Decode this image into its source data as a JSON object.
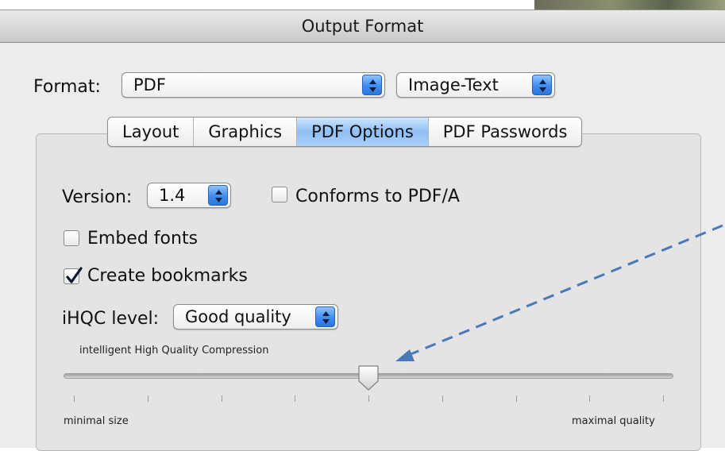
{
  "window": {
    "title": "Output Format"
  },
  "format": {
    "label": "Format:",
    "value": "PDF",
    "mode_value": "Image-Text"
  },
  "tabs": [
    {
      "label": "Layout"
    },
    {
      "label": "Graphics"
    },
    {
      "label": "PDF Options",
      "active": true
    },
    {
      "label": "PDF Passwords"
    }
  ],
  "pdf_options": {
    "version_label": "Version:",
    "version_value": "1.4",
    "conforms_label": "Conforms to PDF/A",
    "conforms_checked": false,
    "embed_fonts_label": "Embed fonts",
    "embed_fonts_checked": false,
    "create_bookmarks_label": "Create bookmarks",
    "create_bookmarks_checked": true,
    "ihqc_label": "iHQC level:",
    "ihqc_value": "Good quality",
    "ihqc_caption": "intelligent High Quality Compression",
    "slider": {
      "min_label": "minimal size",
      "max_label": "maximal quality",
      "value_fraction": 0.5,
      "tick_count": 9
    }
  },
  "colors": {
    "accent": "#3f8df0",
    "annotation_arrow": "#4a78b8"
  },
  "icons": {
    "stepper": "up-down-arrows-icon",
    "checkmark": "checkmark-icon",
    "slider_knob": "slider-knob-icon",
    "annotation": "dashed-arrow-icon"
  }
}
